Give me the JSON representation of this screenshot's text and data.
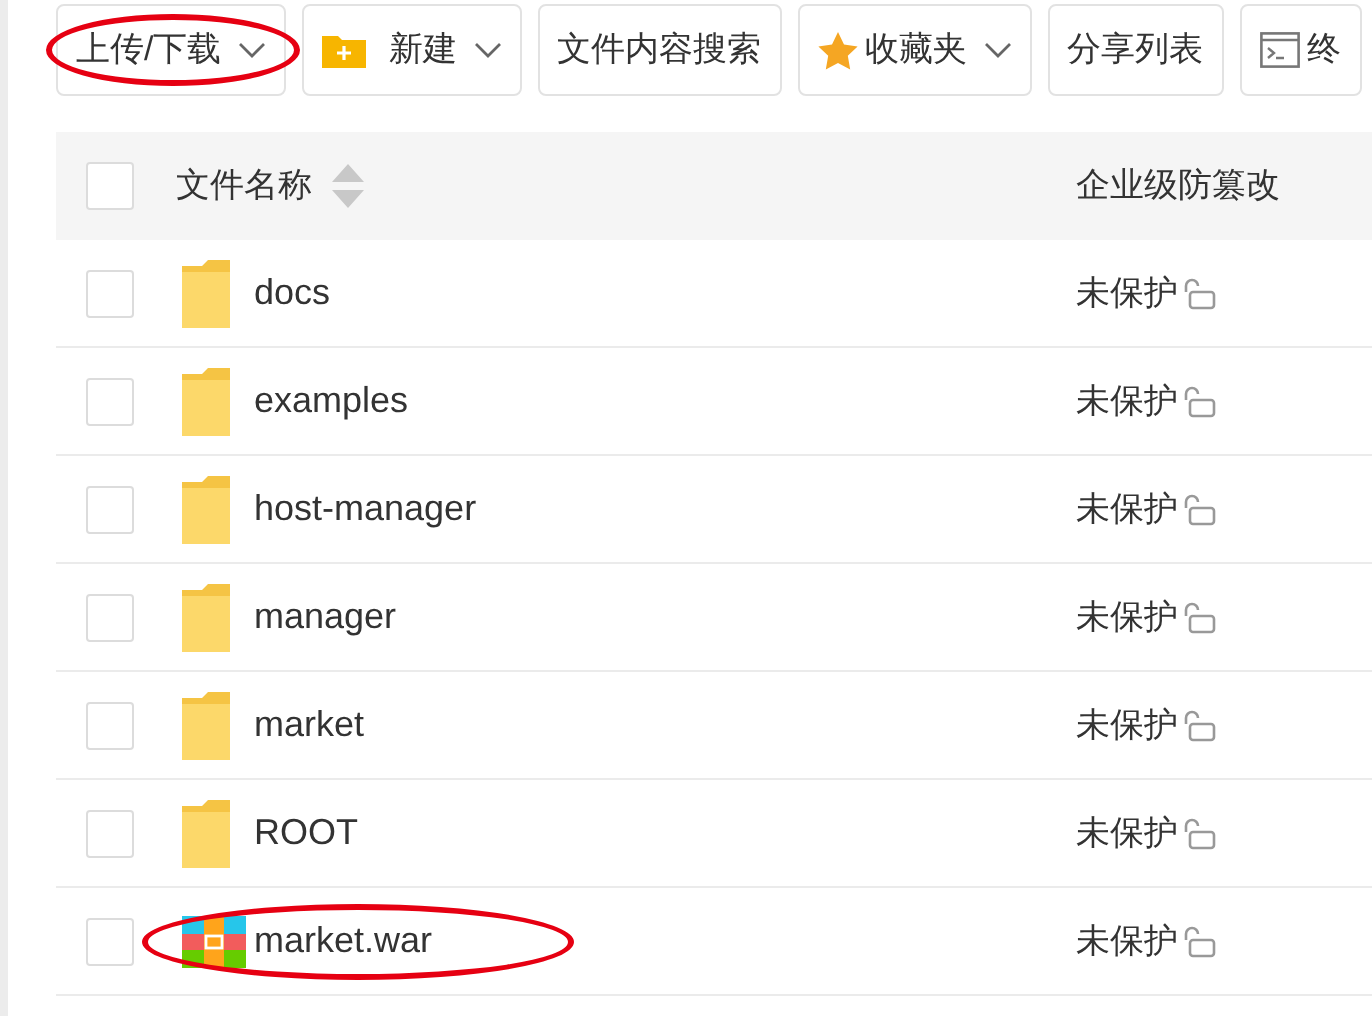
{
  "toolbar": [
    {
      "kind": "dropdown",
      "label": "上传/下载",
      "highlighted": true
    },
    {
      "kind": "new",
      "label": "新建",
      "highlighted": false
    },
    {
      "kind": "plain",
      "label": "文件内容搜索",
      "highlighted": false
    },
    {
      "kind": "favorites",
      "label": "收藏夹",
      "highlighted": false
    },
    {
      "kind": "plain",
      "label": "分享列表",
      "highlighted": false
    },
    {
      "kind": "terminal",
      "label": "终",
      "highlighted": false
    }
  ],
  "table": {
    "columns": [
      "文件名称",
      "企业级防篡改"
    ],
    "all_checked": false,
    "rows": [
      {
        "kind": "folder",
        "name": "docs",
        "protection": "未保护",
        "checked": false,
        "highlighted": false
      },
      {
        "kind": "folder",
        "name": "examples",
        "protection": "未保护",
        "checked": false,
        "highlighted": false
      },
      {
        "kind": "folder",
        "name": "host-manager",
        "protection": "未保护",
        "checked": false,
        "highlighted": false
      },
      {
        "kind": "folder",
        "name": "manager",
        "protection": "未保护",
        "checked": false,
        "highlighted": false
      },
      {
        "kind": "folder",
        "name": "market",
        "protection": "未保护",
        "checked": false,
        "highlighted": false
      },
      {
        "kind": "folder",
        "name": "ROOT",
        "protection": "未保护",
        "checked": false,
        "highlighted": false
      },
      {
        "kind": "archive",
        "name": "market.war",
        "protection": "未保护",
        "checked": false,
        "highlighted": true
      }
    ]
  }
}
